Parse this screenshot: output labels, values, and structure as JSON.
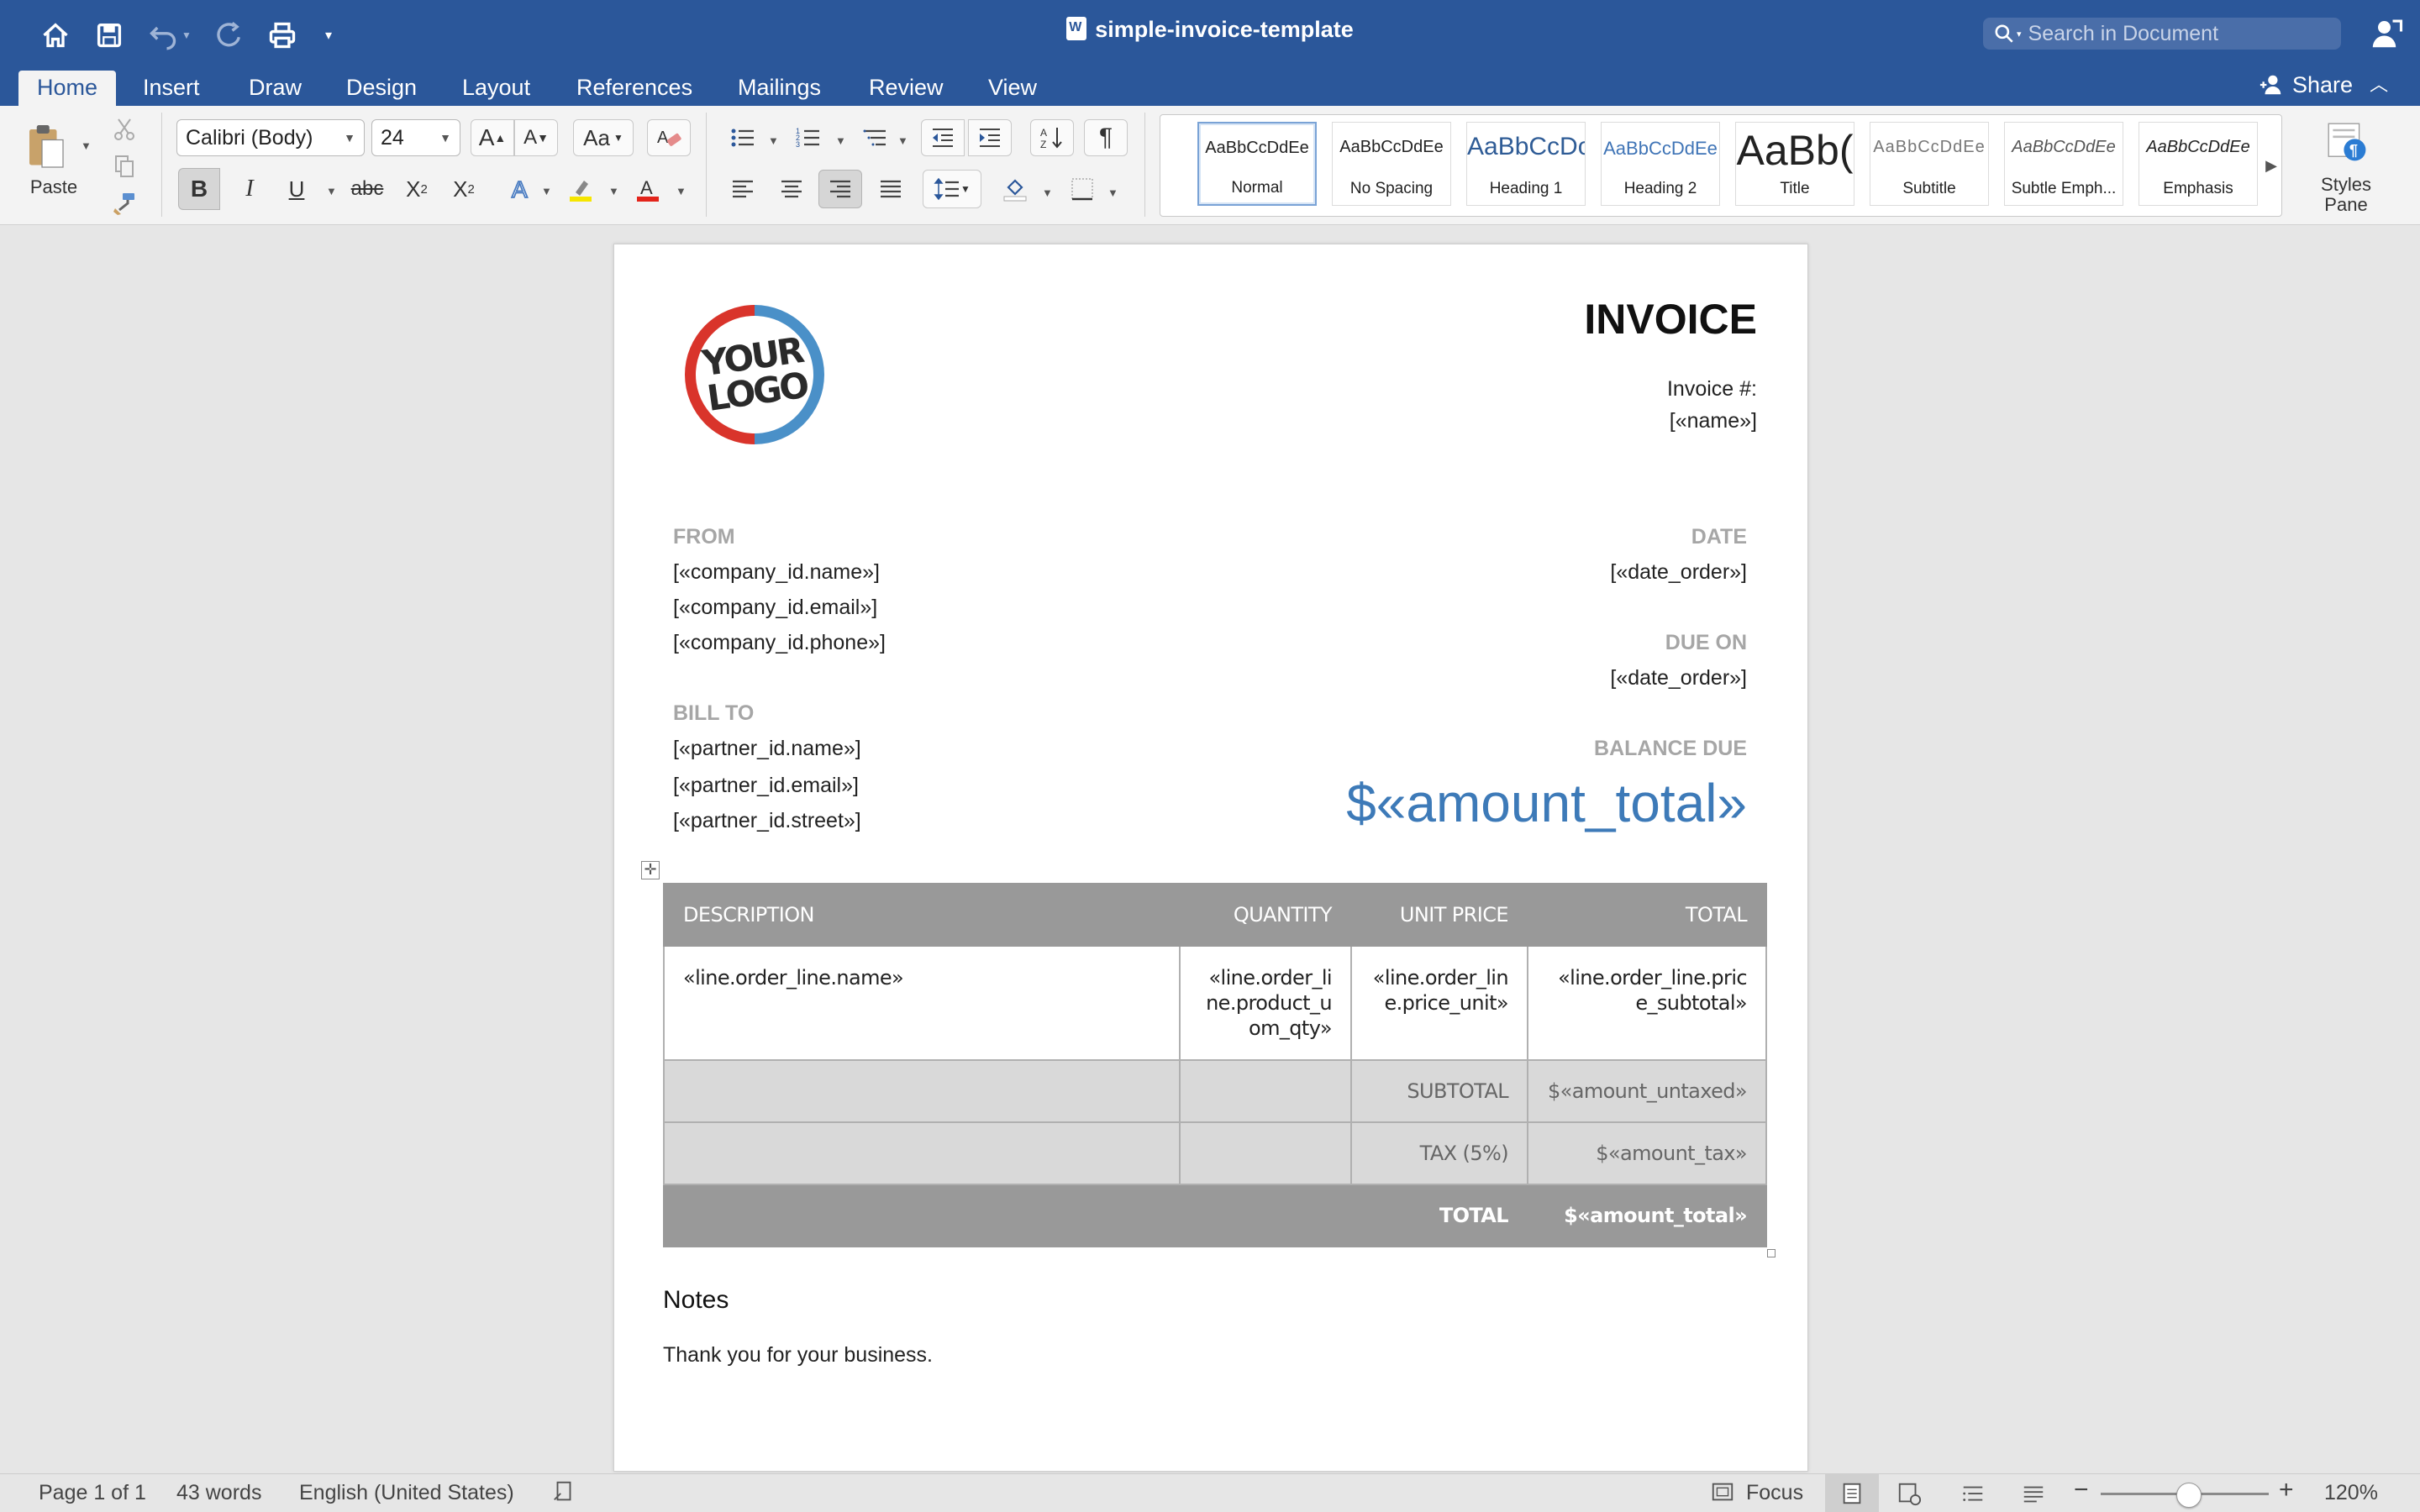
{
  "titlebar": {
    "doc_title": "simple-invoice-template",
    "search_placeholder": "Search in Document"
  },
  "tabs": [
    {
      "label": "Home",
      "active": true
    },
    {
      "label": "Insert"
    },
    {
      "label": "Draw"
    },
    {
      "label": "Design"
    },
    {
      "label": "Layout"
    },
    {
      "label": "References"
    },
    {
      "label": "Mailings"
    },
    {
      "label": "Review"
    },
    {
      "label": "View"
    }
  ],
  "share_label": "Share",
  "ribbon": {
    "paste_label": "Paste",
    "font_name": "Calibri (Body)",
    "font_size": "24",
    "styles": [
      {
        "sample": "AaBbCcDdEe",
        "name": "Normal"
      },
      {
        "sample": "AaBbCcDdEe",
        "name": "No Spacing"
      },
      {
        "sample": "AaBbCcDc",
        "name": "Heading 1"
      },
      {
        "sample": "AaBbCcDdEe",
        "name": "Heading 2"
      },
      {
        "sample": "AaBb(",
        "name": "Title"
      },
      {
        "sample": "AaBbCcDdEe",
        "name": "Subtitle"
      },
      {
        "sample": "AaBbCcDdEe",
        "name": "Subtle Emph..."
      },
      {
        "sample": "AaBbCcDdEe",
        "name": "Emphasis"
      }
    ],
    "styles_pane_label_1": "Styles",
    "styles_pane_label_2": "Pane"
  },
  "document": {
    "logo_line1": "YOUR",
    "logo_line2": "LOGO",
    "invoice_title": "INVOICE",
    "invoice_num_label": "Invoice #:",
    "invoice_num_value": "[«name»]",
    "from_label": "FROM",
    "from_lines": [
      "[«company_id.name»]",
      "[«company_id.email»]",
      "[«company_id.phone»]"
    ],
    "bill_to_label": "BILL TO",
    "bill_to_lines": [
      "[«partner_id.name»]",
      "[«partner_id.email»]",
      "[«partner_id.street»]"
    ],
    "date_label": "DATE",
    "date_value": "[«date_order»]",
    "due_label": "DUE ON",
    "due_value": "[«date_order»]",
    "balance_label": "BALANCE DUE",
    "balance_value": "$«amount_total»",
    "table": {
      "headers": [
        "DESCRIPTION",
        "QUANTITY",
        "UNIT PRICE",
        "TOTAL"
      ],
      "row": {
        "description": "«line.order_line.name»",
        "quantity": [
          "«line.order_li",
          "ne.product_u",
          "om_qty»"
        ],
        "unit_price": [
          "«line.order_lin",
          "e.price_unit»"
        ],
        "total": [
          "«line.order_line.pric",
          "e_subtotal»"
        ]
      },
      "subtotal_label": "SUBTOTAL",
      "subtotal_value": "$«amount_untaxed»",
      "tax_label": "TAX (5%)",
      "tax_value": "$«amount_tax»",
      "total_label": "TOTAL",
      "total_value": "$«amount_total»"
    },
    "notes_title": "Notes",
    "notes_text": "Thank you for your business."
  },
  "statusbar": {
    "page": "Page 1 of 1",
    "words": "43 words",
    "language": "English (United States)",
    "focus": "Focus",
    "zoom": "120%"
  },
  "colors": {
    "brand": "#2b579a",
    "balance_blue": "#3d7ab8",
    "table_header": "#999999",
    "table_summary": "#d9d9d9"
  }
}
